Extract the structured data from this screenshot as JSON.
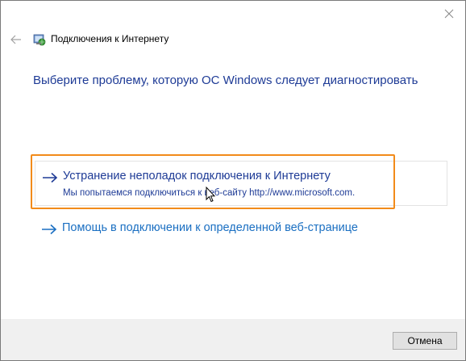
{
  "window": {
    "title": "Подключения к Интернету"
  },
  "main": {
    "heading": "Выберите проблему, которую ОС Windows следует диагностировать",
    "options": [
      {
        "title": "Устранение неполадок подключения к Интернету",
        "description": "Мы попытаемся подключиться к веб-сайту http://www.microsoft.com."
      },
      {
        "title": "Помощь в подключении к определенной веб-странице"
      }
    ]
  },
  "footer": {
    "cancel_label": "Отмена"
  },
  "colors": {
    "link": "#1e3b96",
    "highlight": "#f28b1a",
    "footer_bg": "#f0f0f0"
  },
  "icons": {
    "back": "arrow-left-icon",
    "close": "close-icon",
    "app": "network-globe-icon",
    "option": "arrow-right-icon"
  }
}
